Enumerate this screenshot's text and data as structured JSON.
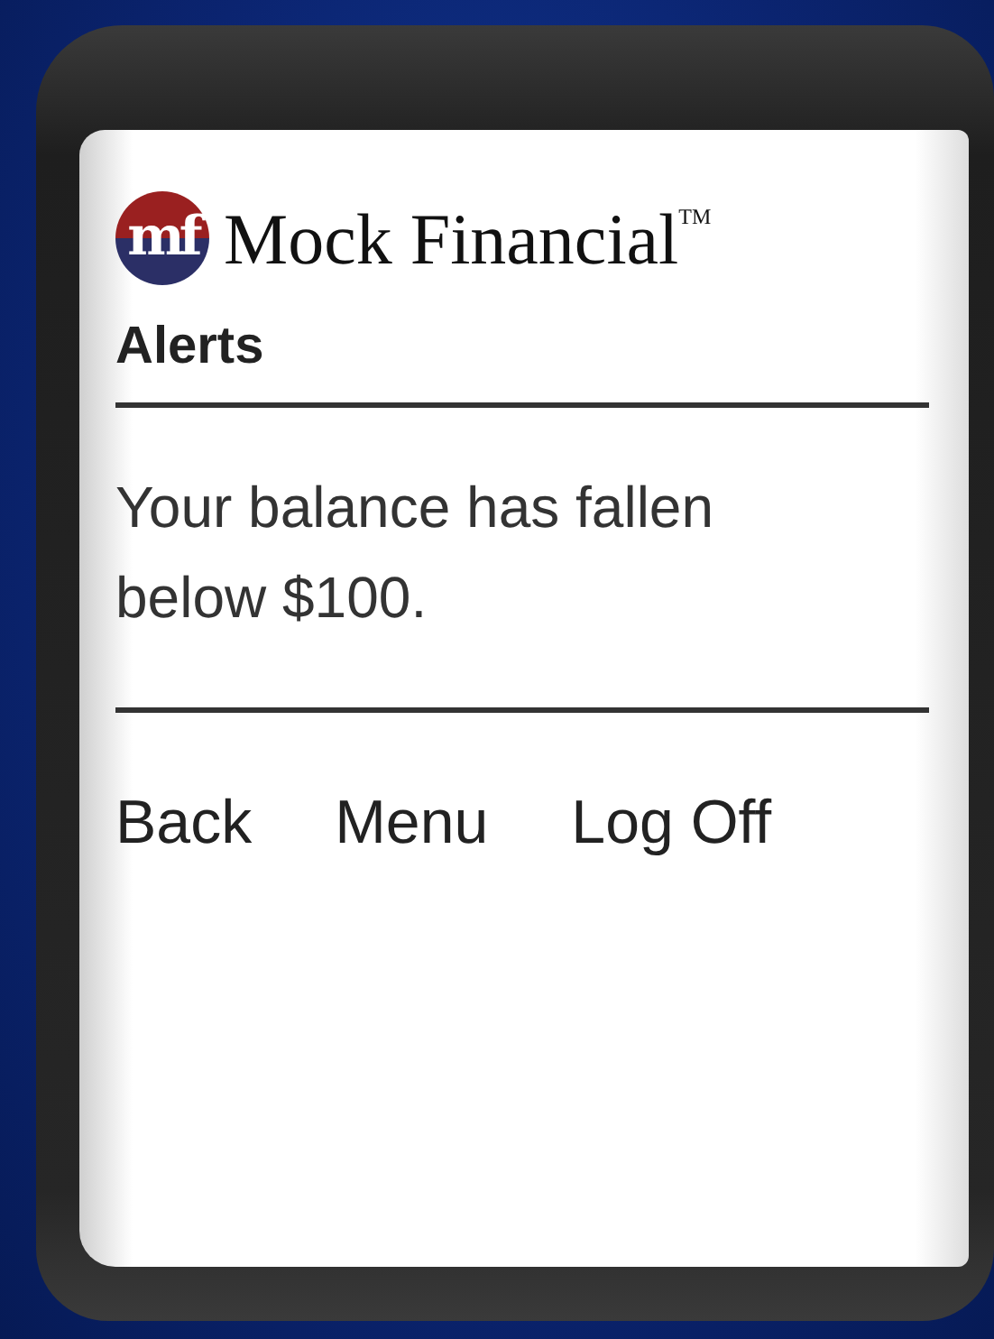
{
  "header": {
    "logo_mark": "mf",
    "brand": "Mock Financial$^{TM}$"
  },
  "page_title": "Alerts",
  "message": "Your balance has fallen below $100.",
  "nav_links": [
    "Back",
    "Menu",
    "Log Off"
  ]
}
